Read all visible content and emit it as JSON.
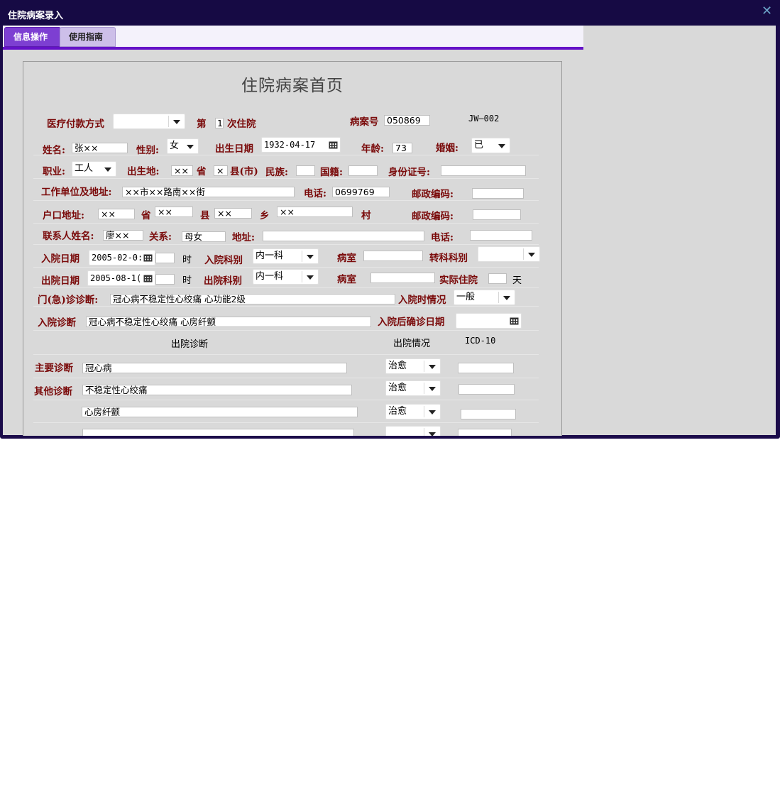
{
  "window": {
    "title": "住院病案录入",
    "close_icon": "close-icon"
  },
  "tabs": [
    {
      "label": "信息操作",
      "active": true
    },
    {
      "label": "使用指南",
      "active": false
    }
  ],
  "form": {
    "heading": "住院病案首页",
    "payment_label": "医疗付款方式",
    "payment_value": "",
    "nth_prefix": "第",
    "nth_value": "1",
    "nth_suffix": "次住院",
    "case_no_label": "病案号",
    "case_no_value": "050869",
    "code_id": "JW—002",
    "name_label": "姓名:",
    "name_value": "张××",
    "sex_label": "性别:",
    "sex_value": "女",
    "birth_label": "出生日期",
    "birth_value": "1932-04-17",
    "age_label": "年龄:",
    "age_value": "73",
    "marriage_label": "婚姻:",
    "marriage_value": "已",
    "job_label": "职业:",
    "job_value": "工人",
    "birthplace_label": "出生地:",
    "birthplace_province_value": "××",
    "province_label": "省",
    "birthplace_county_value": "×",
    "county_city_label": "县(市)",
    "ethnic_label": "民族:",
    "ethnic_value": "",
    "nationality_label": "国籍:",
    "nationality_value": "",
    "id_label": "身份证号:",
    "id_value": "",
    "work_label": "工作单位及地址:",
    "work_value": "××市××路南××街",
    "phone_label": "电话:",
    "phone_value": "0699769",
    "postcode_label": "邮政编码:",
    "postcode_value": "",
    "hukou_label": "户口地址:",
    "hukou_province_value": "××",
    "hukou_province_label": "省",
    "hukou_city_value": "××",
    "hukou_county_label": "县",
    "hukou_county_value": "××",
    "hukou_township_label": "乡",
    "hukou_township_value": "××",
    "hukou_village_label": "村",
    "postcode2_label": "邮政编码:",
    "postcode2_value": "",
    "contact_label": "联系人姓名:",
    "contact_value": "廖××",
    "relation_label": "关系:",
    "relation_value": "母女",
    "address_label": "地址:",
    "address_value": "",
    "contact_phone_label": "电话:",
    "contact_phone_value": "",
    "admit_date_label": "入院日期",
    "admit_date_value": "2005-02-0:",
    "admit_hour_value": "",
    "hour_label": "时",
    "admit_dept_label": "入院科别",
    "admit_dept_value": "内一科",
    "ward_label": "病室",
    "ward_value": "",
    "transfer_label": "转科科别",
    "transfer_value": "",
    "discharge_date_label": "出院日期",
    "discharge_date_value": "2005-08-1(",
    "discharge_hour_value": "",
    "hour2_label": "时",
    "discharge_dept_label": "出院科别",
    "discharge_dept_value": "内一科",
    "ward2_label": "病室",
    "ward2_value": "",
    "stay_label": "实际住院",
    "stay_value": "",
    "day_label": "天",
    "er_diag_label": "门(急)诊诊断:",
    "er_diag_value": "冠心病不稳定性心绞痛 心功能2级",
    "admit_cond_label": "入院时情况",
    "admit_cond_value": "一般",
    "admit_diag_label": "入院诊断",
    "admit_diag_value": "冠心病不稳定性心绞痛 心房纤颤",
    "confirm_date_label": "入院后确诊日期",
    "confirm_date_value": "",
    "col_diag": "出院诊断",
    "col_outcome": "出院情况",
    "col_icd": "ICD-10",
    "main_diag_label": "主要诊断",
    "other_diag_label": "其他诊断",
    "diagnoses": [
      {
        "diag": "冠心病",
        "outcome": "治愈",
        "icd": ""
      },
      {
        "diag": "不稳定性心绞痛",
        "outcome": "治愈",
        "icd": ""
      },
      {
        "diag": "心房纤颤",
        "outcome": "治愈",
        "icd": ""
      },
      {
        "diag": "",
        "outcome": "",
        "icd": ""
      }
    ]
  },
  "colors": {
    "titlebar": "#160a44",
    "accent": "#6512c8",
    "label": "#7a0a0a",
    "panel": "#d9d9d9"
  }
}
